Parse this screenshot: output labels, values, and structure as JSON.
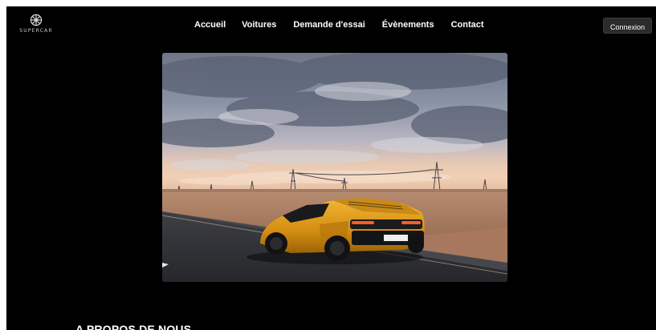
{
  "brand": {
    "logo_text": "SUPERCAR"
  },
  "nav": {
    "links": [
      "Accueil",
      "Voitures",
      "Demande d'essai",
      "Évènements",
      "Contact"
    ],
    "login_label": "Connexion"
  },
  "hero": {
    "subject": "yellow sports car on desert road at dusk"
  },
  "about": {
    "title": "A PROPOS DE NOUS"
  },
  "colors": {
    "background": "#000000",
    "text": "#ffffff",
    "button_bg": "#2b2b2b",
    "car": "#e6a21f"
  }
}
